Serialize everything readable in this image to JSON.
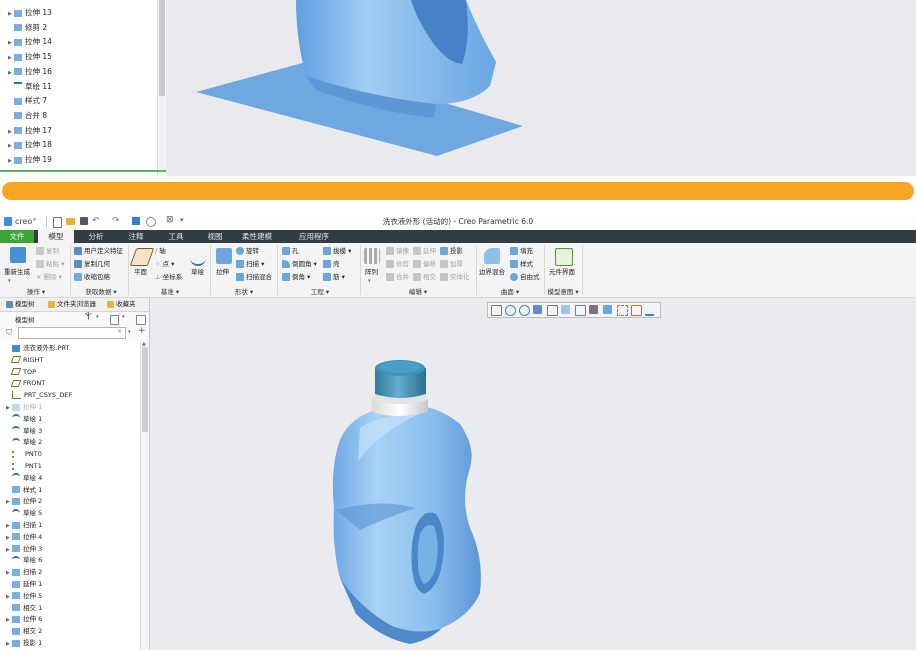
{
  "top_tree": {
    "items": [
      {
        "label": "拉伸 13",
        "icon": "extrude-icon",
        "expandable": true
      },
      {
        "label": "修剪 2",
        "icon": "trim-icon",
        "expandable": false
      },
      {
        "label": "拉伸 14",
        "icon": "extrude-icon",
        "expandable": true
      },
      {
        "label": "拉伸 15",
        "icon": "extrude-icon",
        "expandable": true
      },
      {
        "label": "拉伸 16",
        "icon": "extrude-icon",
        "expandable": true
      },
      {
        "label": "草绘 11",
        "icon": "sketch-icon",
        "expandable": false
      },
      {
        "label": "样式 7",
        "icon": "style-icon",
        "expandable": false
      },
      {
        "label": "合并 8",
        "icon": "merge-icon",
        "expandable": false
      },
      {
        "label": "拉伸 17",
        "icon": "extrude-icon",
        "expandable": true
      },
      {
        "label": "拉伸 18",
        "icon": "extrude-icon",
        "expandable": true
      },
      {
        "label": "拉伸 19",
        "icon": "extrude-icon",
        "expandable": true
      }
    ]
  },
  "window": {
    "app_logo": "creo°",
    "title": "洗衣液外形 (活动的) - Creo Parametric 6.0"
  },
  "menu": {
    "tabs": [
      "文件",
      "模型",
      "分析",
      "注释",
      "工具",
      "视图",
      "柔性建模",
      "应用程序"
    ],
    "active": "模型"
  },
  "ribbon": {
    "regenerate": "重新生成",
    "copy": "复制",
    "paste": "粘贴",
    "delete": "删除",
    "udf": "用户定义特征",
    "copy_geom": "复制几何",
    "shrinkwrap": "收缩包络",
    "plane": "平面",
    "axis": "轴",
    "point": "点",
    "csys": "坐标系",
    "sketch": "草绘",
    "extrude": "拉伸",
    "revolve": "旋转",
    "sweep": "扫描",
    "swept_blend": "扫描混合",
    "hole": "孔",
    "round": "倒圆角",
    "chamfer": "倒角",
    "draft": "拔模",
    "shell": "壳",
    "rib": "筋",
    "pattern": "阵列",
    "mirror": "镜像",
    "extend": "延伸",
    "project": "投影",
    "trim": "修剪",
    "offset": "偏移",
    "thicken": "加厚",
    "merge": "合并",
    "intersect": "相交",
    "solidify": "实体化",
    "boundary_blend": "边界混合",
    "fill": "填充",
    "style": "样式",
    "freestyle": "自由式",
    "component_interface": "元件界面",
    "groups": {
      "operations": "操作",
      "get_data": "获取数据",
      "datum": "基准",
      "shapes": "形状",
      "engineering": "工程",
      "editing": "编辑",
      "surfaces": "曲面",
      "model_intent": "模型意图"
    }
  },
  "nav_tabs": {
    "model_tree": "模型树",
    "folder_browser": "文件夹浏览器",
    "favorites": "收藏夹"
  },
  "model_tree": {
    "header": "模型树",
    "filter_placeholder": "",
    "items": [
      {
        "label": "洗衣液外形.PRT",
        "icon": "part-icon",
        "expandable": false,
        "dim": false
      },
      {
        "label": "RIGHT",
        "icon": "datum-plane-icon",
        "expandable": false,
        "dim": false
      },
      {
        "label": "TOP",
        "icon": "datum-plane-icon",
        "expandable": false,
        "dim": false
      },
      {
        "label": "FRONT",
        "icon": "datum-plane-icon",
        "expandable": false,
        "dim": false
      },
      {
        "label": "PRT_CSYS_DEF",
        "icon": "csys-icon",
        "expandable": false,
        "dim": false
      },
      {
        "label": "拉伸 1",
        "icon": "extrude-icon",
        "expandable": true,
        "dim": true
      },
      {
        "label": "草绘 1",
        "icon": "sketch-icon",
        "expandable": false,
        "dim": false
      },
      {
        "label": "草绘 3",
        "icon": "sketch-icon",
        "expandable": false,
        "dim": false
      },
      {
        "label": "草绘 2",
        "icon": "sketch-icon",
        "expandable": false,
        "dim": false
      },
      {
        "label": "PNT0",
        "icon": "datum-point-icon",
        "expandable": false,
        "dim": false
      },
      {
        "label": "PNT1",
        "icon": "datum-point-icon",
        "expandable": false,
        "dim": false
      },
      {
        "label": "草绘 4",
        "icon": "sketch-icon",
        "expandable": false,
        "dim": false
      },
      {
        "label": "样式 1",
        "icon": "style-icon",
        "expandable": false,
        "dim": false
      },
      {
        "label": "拉伸 2",
        "icon": "extrude-icon",
        "expandable": true,
        "dim": false
      },
      {
        "label": "草绘 5",
        "icon": "sketch-icon",
        "expandable": false,
        "dim": false
      },
      {
        "label": "扫描 1",
        "icon": "sweep-icon",
        "expandable": true,
        "dim": false
      },
      {
        "label": "拉伸 4",
        "icon": "extrude-icon",
        "expandable": true,
        "dim": false
      },
      {
        "label": "拉伸 3",
        "icon": "extrude-icon",
        "expandable": true,
        "dim": false
      },
      {
        "label": "草绘 6",
        "icon": "sketch-icon",
        "expandable": false,
        "dim": false
      },
      {
        "label": "扫描 2",
        "icon": "sweep-icon",
        "expandable": true,
        "dim": false
      },
      {
        "label": "延伸 1",
        "icon": "extend-icon",
        "expandable": false,
        "dim": false
      },
      {
        "label": "拉伸 5",
        "icon": "extrude-icon",
        "expandable": true,
        "dim": false
      },
      {
        "label": "相交 1",
        "icon": "intersect-icon",
        "expandable": false,
        "dim": false
      },
      {
        "label": "拉伸 6",
        "icon": "extrude-icon",
        "expandable": true,
        "dim": false
      },
      {
        "label": "相交 2",
        "icon": "intersect-icon",
        "expandable": false,
        "dim": false
      },
      {
        "label": "投影 1",
        "icon": "project-icon",
        "expandable": true,
        "dim": false
      }
    ]
  },
  "colors": {
    "accent_orange": "#f7a623",
    "menubar": "#323c43",
    "file_tab": "#3aa534",
    "model_blue": "#8fc3ee",
    "cap_teal": "#3f8fb0",
    "viewport_bg": "#e9ebee"
  }
}
